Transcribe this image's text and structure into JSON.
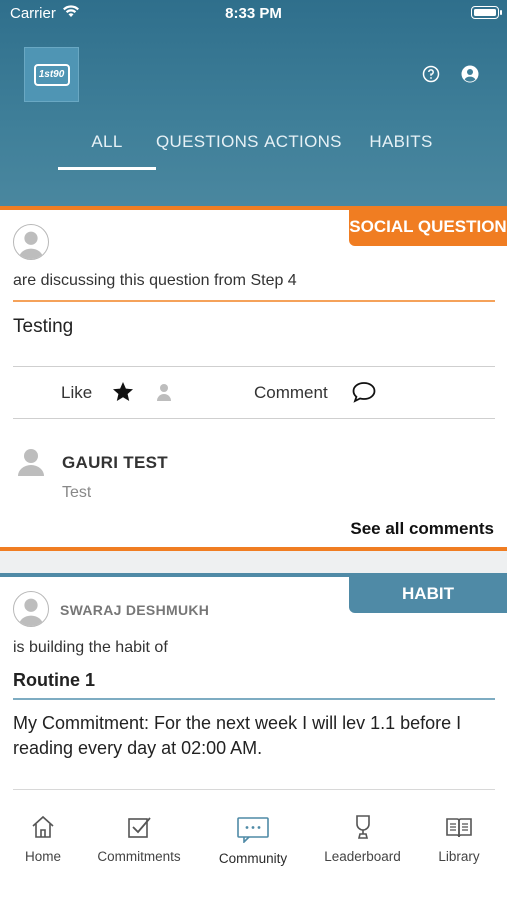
{
  "status_bar": {
    "carrier": "Carrier",
    "time": "8:33 PM"
  },
  "header": {
    "logo_text": "1st90",
    "tabs": [
      {
        "label": "ALL",
        "active": true
      },
      {
        "label": "QUESTIONS",
        "active": false
      },
      {
        "label": "ACTIONS",
        "active": false
      },
      {
        "label": "HABITS",
        "active": false
      }
    ]
  },
  "feed": {
    "social_question": {
      "badge": "SOCIAL QUESTION",
      "subtitle": "are discussing this question from Step 4",
      "text": "Testing",
      "like_label": "Like",
      "comment_label": "Comment",
      "comment": {
        "name": "GAURI TEST",
        "text": "Test"
      },
      "see_all": "See all comments"
    },
    "habit": {
      "badge": "HABIT",
      "poster": "SWARAJ DESHMUKH",
      "subtitle": "is building the habit of",
      "title": "Routine 1",
      "commitment": "My Commitment: For the next week I will lev 1.1 before I reading every day at 02:00 AM."
    }
  },
  "tab_bar": {
    "items": [
      {
        "label": "Home",
        "icon": "home-icon"
      },
      {
        "label": "Commitments",
        "icon": "checkbox-icon"
      },
      {
        "label": "Community",
        "icon": "chat-bubbles-icon",
        "selected": true
      },
      {
        "label": "Leaderboard",
        "icon": "trophy-icon"
      },
      {
        "label": "Library",
        "icon": "book-icon"
      }
    ]
  },
  "colors": {
    "header": "#3f7f99",
    "accent_orange": "#f07d22",
    "accent_blue": "#4f8aa6"
  }
}
